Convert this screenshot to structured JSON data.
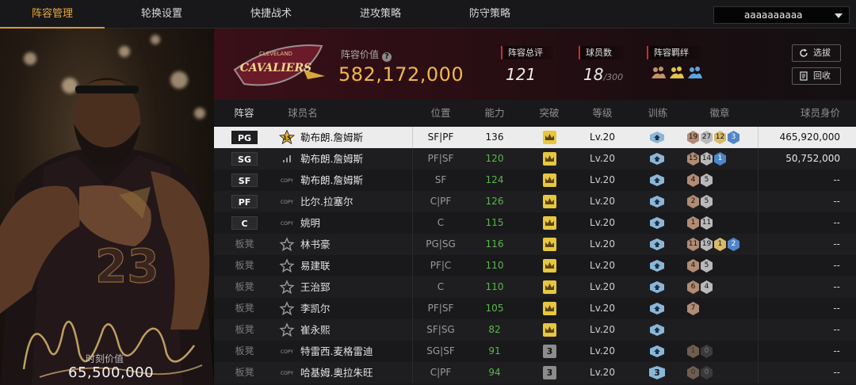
{
  "nav": {
    "tabs": [
      "阵容管理",
      "轮换设置",
      "快捷战术",
      "进攻策略",
      "防守策略"
    ],
    "active_tab": "阵容管理",
    "team_select_value": "aaaaaaaaaa"
  },
  "player_panel": {
    "jersey_number": "23",
    "time_value_label": "时刻价值",
    "time_value": "65,500,000"
  },
  "team": {
    "logo_text": "CAVALIERS",
    "logo_subtext": "CLEVELAND",
    "lineup_value_label": "阵容价值",
    "lineup_value": "582,172,000",
    "rating_label": "阵容总评",
    "rating_value": "121",
    "players_label": "球员数",
    "players_value": "18",
    "players_max": "/300",
    "bond_label": "阵容羁绊",
    "buttons": {
      "scout": "选拔",
      "recycle": "回收"
    }
  },
  "table": {
    "headers": [
      "阵容",
      "球员名",
      "位置",
      "能力",
      "突破",
      "等级",
      "训练",
      "徽章",
      "球员身价"
    ],
    "rows": [
      {
        "slot": "PG",
        "card": "15",
        "name": "勒布朗.詹姆斯",
        "position": "SF|PF",
        "ability": "136",
        "breakthrough": "crown",
        "level": "Lv.20",
        "training": "icon",
        "badges": [
          [
            "19",
            "bronze"
          ],
          [
            "27",
            "silver"
          ],
          [
            "12",
            "gold"
          ],
          [
            "3",
            "blue"
          ]
        ],
        "value": "465,920,000"
      },
      {
        "slot": "SG",
        "card": "bars",
        "name": "勒布朗.詹姆斯",
        "position": "PF|SF",
        "ability": "120",
        "breakthrough": "crown",
        "level": "Lv.20",
        "training": "icon",
        "badges": [
          [
            "15",
            "bronze"
          ],
          [
            "14",
            "silver"
          ],
          [
            "1",
            "blue"
          ]
        ],
        "value": "50,752,000"
      },
      {
        "slot": "SF",
        "card": "COPY",
        "name": "勒布朗.詹姆斯",
        "position": "SF",
        "ability": "124",
        "breakthrough": "crown",
        "level": "Lv.20",
        "training": "icon",
        "badges": [
          [
            "4",
            "bronze"
          ],
          [
            "5",
            "silver"
          ]
        ],
        "value": "--"
      },
      {
        "slot": "PF",
        "card": "COPY",
        "name": "比尔.拉塞尔",
        "position": "C|PF",
        "ability": "126",
        "breakthrough": "crown",
        "level": "Lv.20",
        "training": "icon",
        "badges": [
          [
            "2",
            "bronze"
          ],
          [
            "5",
            "silver"
          ]
        ],
        "value": "--"
      },
      {
        "slot": "C",
        "card": "COPY",
        "name": "姚明",
        "position": "C",
        "ability": "115",
        "breakthrough": "crown",
        "level": "Lv.20",
        "training": "icon",
        "badges": [
          [
            "1",
            "bronze"
          ],
          [
            "11",
            "silver"
          ]
        ],
        "value": "--"
      },
      {
        "slot": "板凳",
        "card": "star",
        "name": "林书豪",
        "position": "PG|SG",
        "ability": "116",
        "breakthrough": "crown",
        "level": "Lv.20",
        "training": "icon",
        "badges": [
          [
            "11",
            "bronze"
          ],
          [
            "19",
            "silver"
          ],
          [
            "1",
            "gold"
          ],
          [
            "2",
            "blue"
          ]
        ],
        "value": "--"
      },
      {
        "slot": "板凳",
        "card": "star",
        "name": "易建联",
        "position": "PF|C",
        "ability": "110",
        "breakthrough": "crown",
        "level": "Lv.20",
        "training": "icon",
        "badges": [
          [
            "4",
            "bronze"
          ],
          [
            "5",
            "silver"
          ]
        ],
        "value": "--"
      },
      {
        "slot": "板凳",
        "card": "star",
        "name": "王治郅",
        "position": "C",
        "ability": "110",
        "breakthrough": "crown",
        "level": "Lv.20",
        "training": "icon",
        "badges": [
          [
            "6",
            "bronze"
          ],
          [
            "4",
            "silver"
          ]
        ],
        "value": "--"
      },
      {
        "slot": "板凳",
        "card": "star",
        "name": "李凯尔",
        "position": "PF|SF",
        "ability": "105",
        "breakthrough": "crown",
        "level": "Lv.20",
        "training": "icon",
        "badges": [
          [
            "7",
            "bronze"
          ]
        ],
        "value": "--"
      },
      {
        "slot": "板凳",
        "card": "star",
        "name": "崔永熙",
        "position": "SF|SG",
        "ability": "82",
        "breakthrough": "crown",
        "level": "Lv.20",
        "training": "icon",
        "badges": [],
        "value": "--"
      },
      {
        "slot": "板凳",
        "card": "COPY",
        "name": "特雷西.麦格雷迪",
        "position": "SG|SF",
        "ability": "91",
        "breakthrough": "3",
        "level": "Lv.20",
        "training": "icon",
        "badges": [
          [
            "1",
            "dark2"
          ],
          [
            "0",
            "dark"
          ]
        ],
        "value": "--"
      },
      {
        "slot": "板凳",
        "card": "COPY",
        "name": "哈基姆.奥拉朱旺",
        "position": "C|PF",
        "ability": "94",
        "breakthrough": "3",
        "level": "Lv.20",
        "training": "3",
        "badges": [
          [
            "0",
            "dark2"
          ],
          [
            "0",
            "dark"
          ]
        ],
        "value": "--"
      }
    ]
  },
  "colors": {
    "accent": "#e7a93b",
    "ability_green": "#58b84a",
    "crown_gold": "#e7c640",
    "value_gold": "#efb84a"
  }
}
